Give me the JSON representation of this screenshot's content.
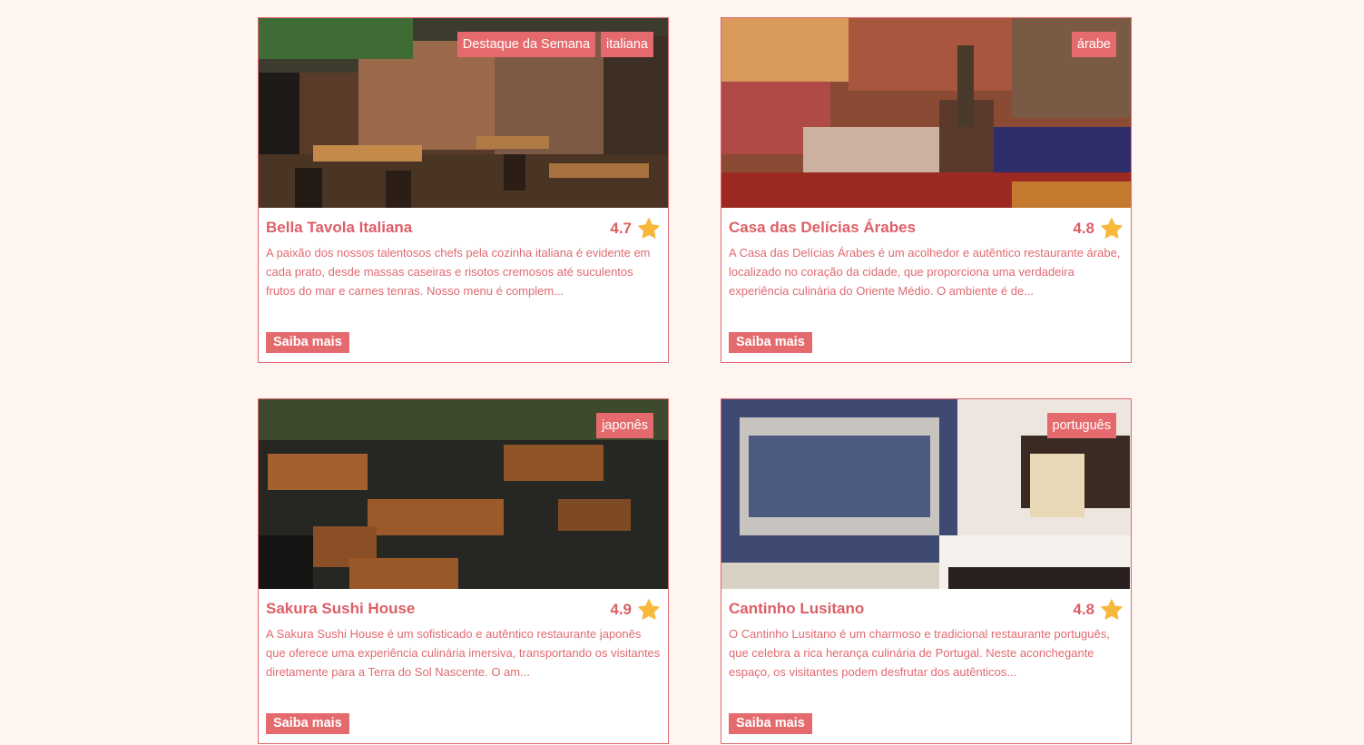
{
  "restaurants": [
    {
      "name": "Bella Tavola Italiana",
      "rating": "4.7",
      "badges": [
        "Destaque da Semana",
        "italiana"
      ],
      "description": "A paixão dos nossos talentosos chefs pela cozinha italiana é evidente em cada prato, desde massas caseiras e risotos cremosos até suculentos frutos do mar e carnes tenras. Nosso menu é complem...",
      "button": "Saiba mais"
    },
    {
      "name": "Casa das Delícias Árabes",
      "rating": "4.8",
      "badges": [
        "árabe"
      ],
      "description": "A Casa das Delícias Árabes é um acolhedor e autêntico restaurante árabe, localizado no coração da cidade, que proporciona uma verdadeira experiência culinária do Oriente Médio. O ambiente é de...",
      "button": "Saiba mais"
    },
    {
      "name": "Sakura Sushi House",
      "rating": "4.9",
      "badges": [
        "japonês"
      ],
      "description": "A Sakura Sushi House é um sofisticado e autêntico restaurante japonês que oferece uma experiência culinária imersiva, transportando os visitantes diretamente para a Terra do Sol Nascente. O am...",
      "button": "Saiba mais"
    },
    {
      "name": "Cantinho Lusitano",
      "rating": "4.8",
      "badges": [
        "português"
      ],
      "description": "O Cantinho Lusitano é um charmoso e tradicional restaurante português, que celebra a rica herança culinária de Portugal. Neste aconchegante espaço, os visitantes podem desfrutar dos autênticos...",
      "button": "Saiba mais"
    }
  ],
  "colors": {
    "accent": "#e56a6e",
    "text": "#dc5f66",
    "star": "#f8b83c",
    "background": "#fff6f2"
  },
  "icons": {
    "rating": "star-icon"
  }
}
